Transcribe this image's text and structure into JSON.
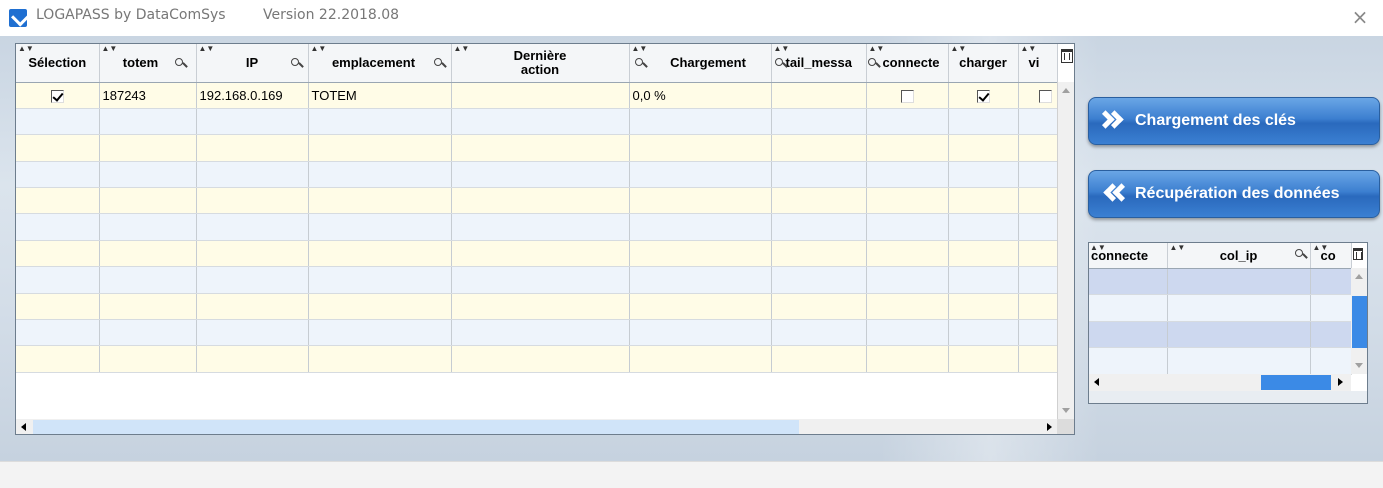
{
  "window": {
    "title": "LOGAPASS by DataComSys",
    "version": "Version  22.2018.08",
    "close_glyph": "×"
  },
  "main_grid": {
    "columns": [
      {
        "label": "Sélection",
        "filter": false
      },
      {
        "label": "totem",
        "filter": true
      },
      {
        "label": "IP",
        "filter": true
      },
      {
        "label": "emplacement",
        "filter": true
      },
      {
        "label": "Dernière action",
        "filter": false
      },
      {
        "label": "Chargement",
        "filter": true
      },
      {
        "label": "tail_messa",
        "filter": true
      },
      {
        "label": "connecte",
        "filter": false
      },
      {
        "label": "charger",
        "filter": false
      },
      {
        "label": "vi",
        "filter": false
      }
    ],
    "rows": [
      {
        "selection": true,
        "totem": "187243",
        "ip": "192.168.0.169",
        "emplacement": "TOTEM",
        "derniere_action": "",
        "chargement": "0,0 %",
        "detail_message": "",
        "connecte": false,
        "charger": true,
        "vide": false
      }
    ],
    "empty_row_count": 10
  },
  "buttons": {
    "load_keys": {
      "label": "Chargement des clés",
      "icon": "double-chevron-right-icon"
    },
    "recover_data": {
      "label": "Récupération des données",
      "icon": "double-chevron-left-icon"
    }
  },
  "mini_grid": {
    "columns": [
      {
        "label": "connecte",
        "filter": false
      },
      {
        "label": "col_ip",
        "filter": true
      },
      {
        "label": "co",
        "filter": false
      }
    ],
    "rows": 4
  },
  "colors": {
    "accent_button": "#3c7fd0",
    "row_yellow": "#fffce7",
    "row_blue": "#eef4fb",
    "selected_row": "#cdd8ef",
    "scroll_thumb": "#3b8ae6"
  }
}
